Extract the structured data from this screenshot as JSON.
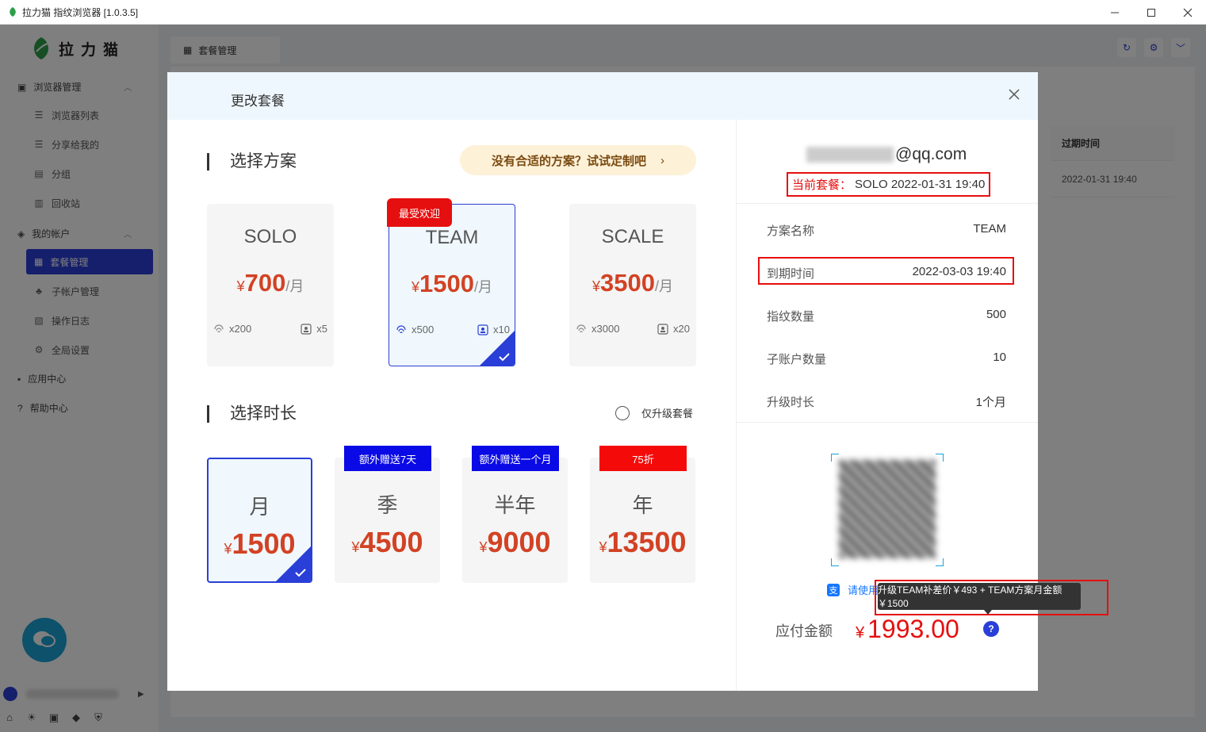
{
  "window": {
    "title": "拉力猫 指纹浏览器 [1.0.3.5]"
  },
  "sidebar": {
    "logo_text": "拉力猫",
    "groups": [
      {
        "label": "浏览器管理",
        "items": [
          "浏览器列表",
          "分享给我的",
          "分组",
          "回收站"
        ]
      },
      {
        "label": "我的帐户",
        "items": [
          "套餐管理",
          "子帐户管理",
          "操作日志",
          "全局设置"
        ]
      },
      {
        "label": "应用中心",
        "items": []
      },
      {
        "label": "帮助中心",
        "items": []
      }
    ],
    "active_item": "套餐管理"
  },
  "main": {
    "tab_label": "套餐管理",
    "table": {
      "column": "过期时间",
      "cell": "2022-01-31 19:40"
    }
  },
  "modal": {
    "title": "更改套餐",
    "plan_section_title": "选择方案",
    "custom_plan_prompt": "没有合适的方案？试试定制吧",
    "currency": "¥",
    "unit": "/月",
    "popular_tag": "最受欢迎",
    "plans": [
      {
        "name": "SOLO",
        "price": "700",
        "fingerprints": "x200",
        "subaccounts": "x5",
        "selected": false
      },
      {
        "name": "TEAM",
        "price": "1500",
        "fingerprints": "x500",
        "subaccounts": "x10",
        "selected": true
      },
      {
        "name": "SCALE",
        "price": "3500",
        "fingerprints": "x3000",
        "subaccounts": "x20",
        "selected": false
      }
    ],
    "duration_section_title": "选择时长",
    "upgrade_only_label": "仅升级套餐",
    "durations": [
      {
        "name": "月",
        "price": "1500",
        "badge": "",
        "badge_color": "",
        "selected": true
      },
      {
        "name": "季",
        "price": "4500",
        "badge": "额外赠送7天",
        "badge_color": "#0a0ae6",
        "selected": false
      },
      {
        "name": "半年",
        "price": "9000",
        "badge": "额外赠送一个月",
        "badge_color": "#0a0ae6",
        "selected": false
      },
      {
        "name": "年",
        "price": "13500",
        "badge": "75折",
        "badge_color": "#f50a0a",
        "selected": false
      }
    ],
    "summary": {
      "email_domain": "@qq.com",
      "current_plan_label": "当前套餐：",
      "current_plan_value": "SOLO 2022-01-31 19:40",
      "rows": [
        {
          "key": "方案名称",
          "value": "TEAM"
        },
        {
          "key": "到期时间",
          "value": "2022-03-03 19:40"
        },
        {
          "key": "指纹数量",
          "value": "500"
        },
        {
          "key": "子账户数量",
          "value": "10"
        },
        {
          "key": "升级时长",
          "value": "1个月"
        }
      ],
      "alipay_hint": "请使用",
      "tooltip": "升级TEAM补差价￥493 + TEAM方案月金额￥1500",
      "amount_label": "应付金额",
      "amount_currency": "¥",
      "amount_value": "1993.00",
      "help_icon_text": "?"
    }
  },
  "colors": {
    "accent": "#2a3fd7",
    "price_red": "#d24224",
    "highlight_red": "#e60f0f"
  }
}
